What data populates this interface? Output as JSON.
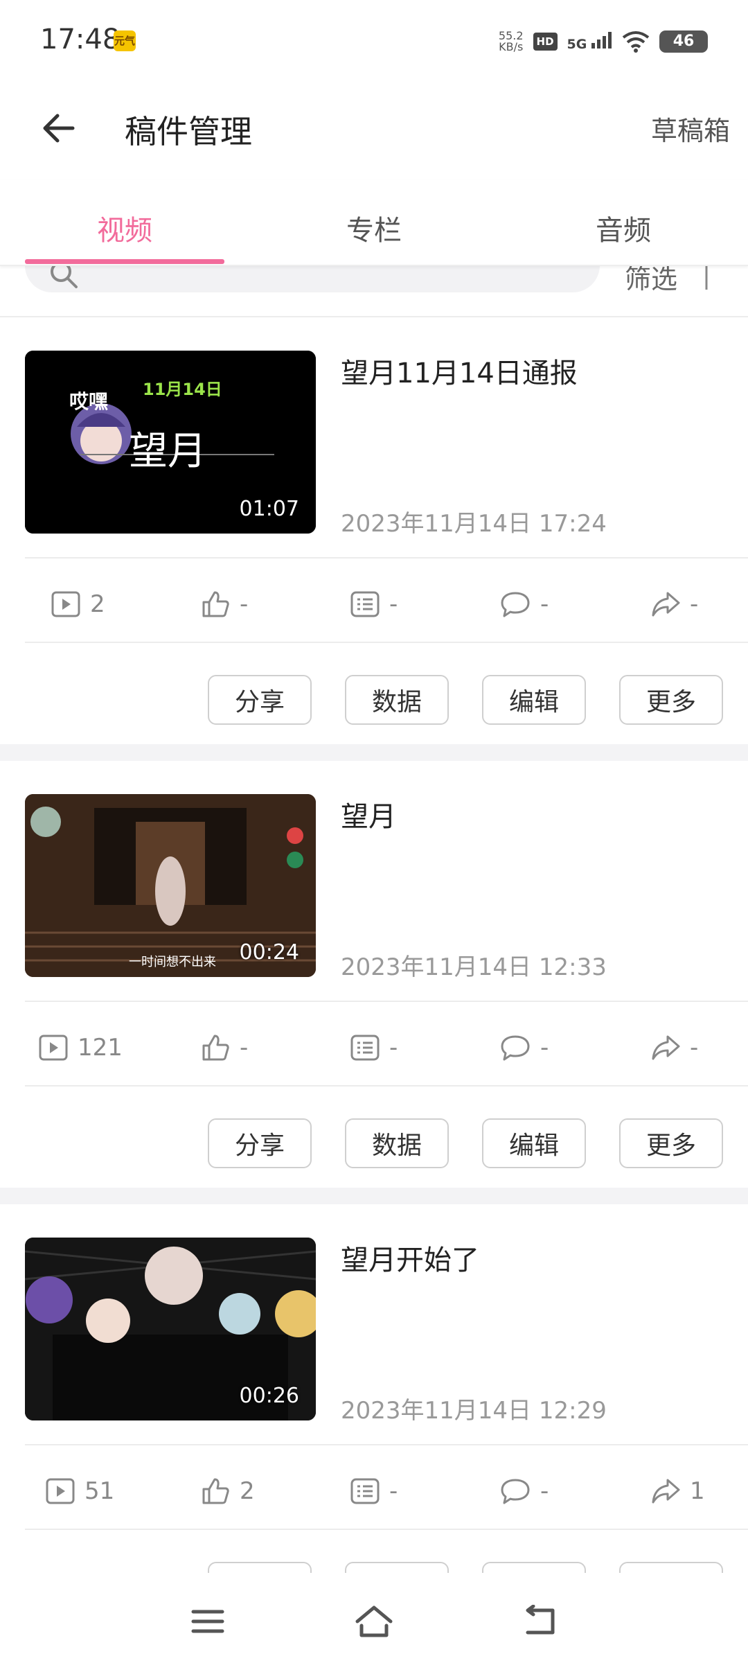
{
  "status_bar": {
    "time": "17:48",
    "app_badge": "元气",
    "net_speed_value": "55.2",
    "net_speed_unit": "KB/s",
    "hd": "HD",
    "network": "5G",
    "battery": "46"
  },
  "header": {
    "title": "稿件管理",
    "drafts_label": "草稿箱"
  },
  "tabs": [
    {
      "label": "视频",
      "active": true
    },
    {
      "label": "专栏",
      "active": false
    },
    {
      "label": "音频",
      "active": false
    }
  ],
  "filter_label": "筛选",
  "actions": {
    "share": "分享",
    "data": "数据",
    "edit": "编辑",
    "more": "更多"
  },
  "videos": [
    {
      "title": "望月11月14日通报",
      "date": "2023年11月14日 17:24",
      "duration": "01:07",
      "thumb_text": {
        "a": "哎嘿",
        "b": "11月14日",
        "c": "望月"
      },
      "stats": {
        "plays": "2",
        "likes": "-",
        "danmaku": "-",
        "comments": "-",
        "shares": "-"
      }
    },
    {
      "title": "望月",
      "date": "2023年11月14日 12:33",
      "duration": "00:24",
      "thumb_text": {
        "a": "一时间想不出来"
      },
      "stats": {
        "plays": "121",
        "likes": "-",
        "danmaku": "-",
        "comments": "-",
        "shares": "-"
      }
    },
    {
      "title": "望月开始了",
      "date": "2023年11月14日 12:29",
      "duration": "00:26",
      "stats": {
        "plays": "51",
        "likes": "2",
        "danmaku": "-",
        "comments": "-",
        "shares": "1"
      }
    }
  ],
  "colors": {
    "accent": "#f26b9b",
    "text_primary": "#222222",
    "text_secondary": "#999999",
    "divider": "#ececec"
  }
}
